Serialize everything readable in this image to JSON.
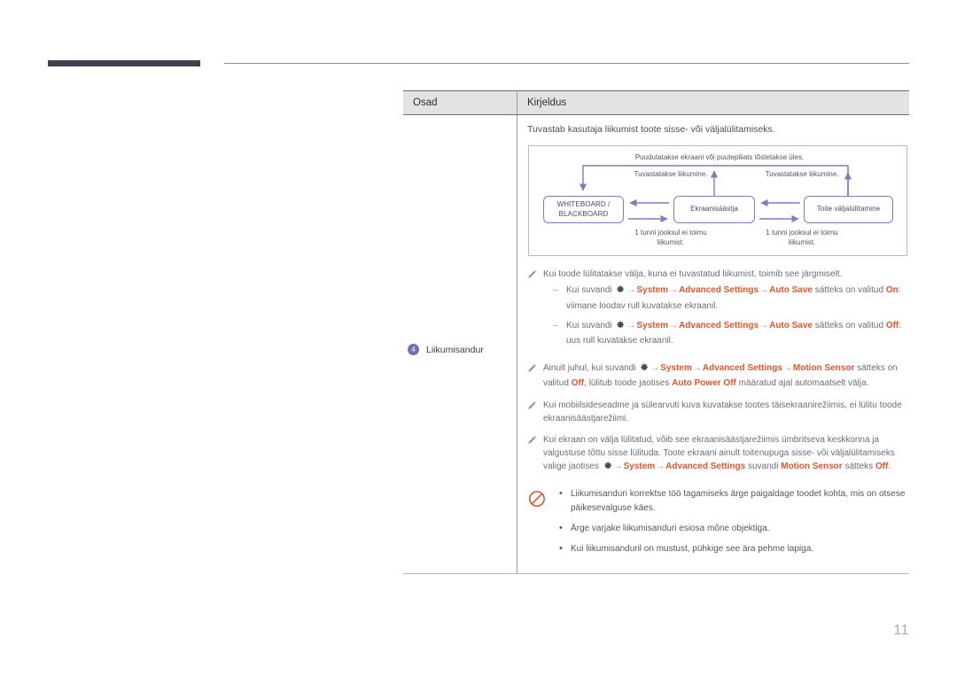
{
  "header": {
    "bar_color": "#413f50",
    "rule_color": "#8e8e93"
  },
  "table": {
    "columns": [
      "Osad",
      "Kirjeldus"
    ],
    "part": {
      "number": "4",
      "label": "Liikumisandur",
      "badge_color": "#6f71b5"
    },
    "intro": "Tuvastab kasutaja liikumist toote sisse- või väljalülitamiseks."
  },
  "diagram": {
    "caption_top": "Puudutatakse ekraani või puutepliiats tõstetakse üles.",
    "caption_mid_left": "Tuvastatakse liikumine.",
    "caption_mid_right": "Tuvastatakse liikumine.",
    "caption_bottom_left": "1 tunni jooksul ei toimu liikumist.",
    "caption_bottom_right": "1 tunni jooksul ei toimu liikumist.",
    "box_left_line1": "WHITEBOARD /",
    "box_left_line2": "BLACKBOARD",
    "box_mid": "Ekraanisäästja",
    "box_right": "Toite väljalülitamine",
    "line_color": "#7a7ec4"
  },
  "notes": {
    "accent_color": "#e0562a",
    "note1": {
      "text": "Kui toode lülitatakse välja, kuna ei tuvastatud liikumist, toimib see järgmiselt.",
      "sub1": {
        "lead": "Kui suvandi",
        "path1": "System",
        "path2": "Advanced Settings",
        "path3": "Auto Save",
        "mid": "sätteks on valitud",
        "value": "On",
        "tail": ": viimane loodav rull kuvatakse ekraanil."
      },
      "sub2": {
        "lead": "Kui suvandi",
        "path1": "System",
        "path2": "Advanced Settings",
        "path3": "Auto Save",
        "mid": "sätteks on valitud",
        "value": "Off",
        "tail": ": uus rull kuvatakse ekraanil."
      }
    },
    "note2": {
      "lead": "Ainult juhul, kui suvandi",
      "path1": "System",
      "path2": "Advanced Settings",
      "path3": "Motion Sensor",
      "mid": "sätteks on valitud",
      "value": "Off",
      "mid2": ", lülitub toode jaotises",
      "value2": "Auto Power Off",
      "tail": "määratud ajal automaatselt välja."
    },
    "note3": {
      "text": "Kui mobiilsideseadme ja sülearvuti kuva kuvatakse tootes täisekraanirežiimis, ei lülitu toode ekraanisäästjarežiimi."
    },
    "note4": {
      "lead": "Kui ekraan on välja lülitatud, võib see ekraanisäästjarežiimis ümbritseva keskkonna ja valgustuse tõttu sisse lülituda. Toote ekraani ainult toitenupuga sisse- või väljalülitamiseks valige jaotises",
      "path1": "System",
      "path2": "Advanced Settings",
      "mid": "suvandi",
      "value": "Motion Sensor",
      "mid2": "sätteks",
      "value2": "Off",
      "tail": "."
    }
  },
  "caution": {
    "icon": "prohibition-icon",
    "icon_color": "#e0401f",
    "items": [
      "Liikumisanduri korrektse töö tagamiseks ärge paigaldage toodet kohta, mis on otsese päikesevalguse käes.",
      "Ärge varjake liikumisanduri esiosa mõne objektiga.",
      "Kui liikumisanduril on mustust, pühkige see ära pehme lapiga."
    ]
  },
  "footer": {
    "page_number": "11"
  }
}
